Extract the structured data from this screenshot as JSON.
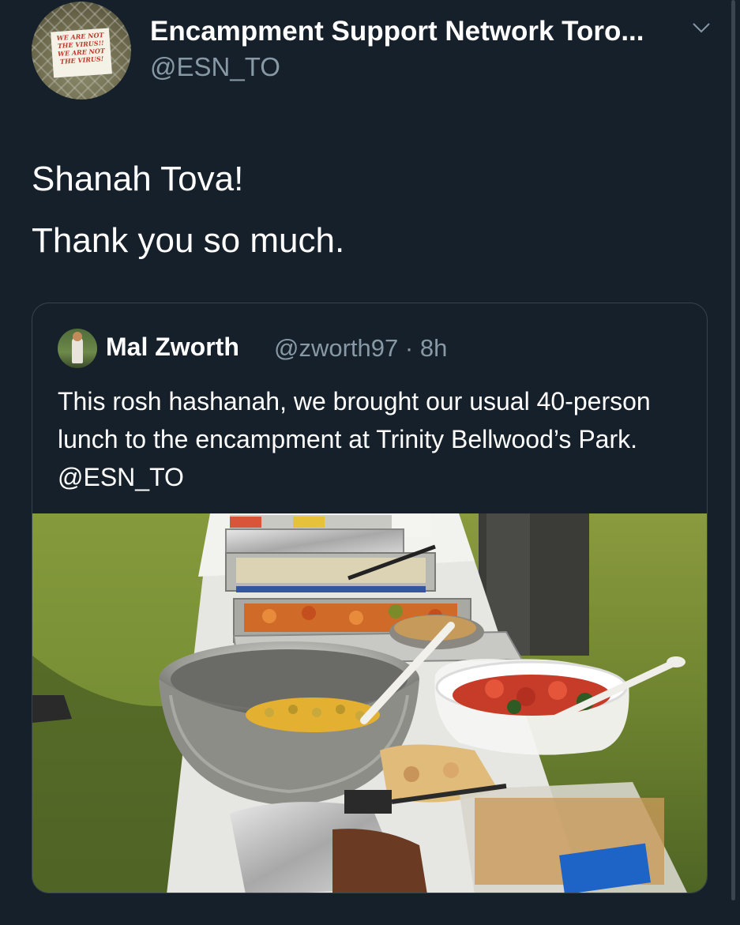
{
  "tweet": {
    "author": {
      "display_name": "Encampment Support Network Toro...",
      "handle": "@ESN_TO",
      "avatar_sign_lines": [
        "WE ARE NOT",
        "THE VIRUS!!",
        "WE ARE NOT",
        "THE VIRUS!"
      ]
    },
    "text_lines": [
      "Shanah Tova!",
      "Thank you so much."
    ],
    "menu_icon": "chevron-down-icon"
  },
  "quoted_tweet": {
    "author": {
      "display_name": "Mal Zworth",
      "handle": "@zworth97",
      "separator": "·",
      "time": "8h"
    },
    "text": "This rosh hashanah, we brought our usual 40-person lunch to the encampment at Trinity Bellwood’s Park. @ESN_TO",
    "media": {
      "type": "photo",
      "subject": "food trays on a table in a park"
    }
  },
  "colors": {
    "background": "#15202b",
    "secondary_text": "#8899a6",
    "border": "#38444d"
  }
}
